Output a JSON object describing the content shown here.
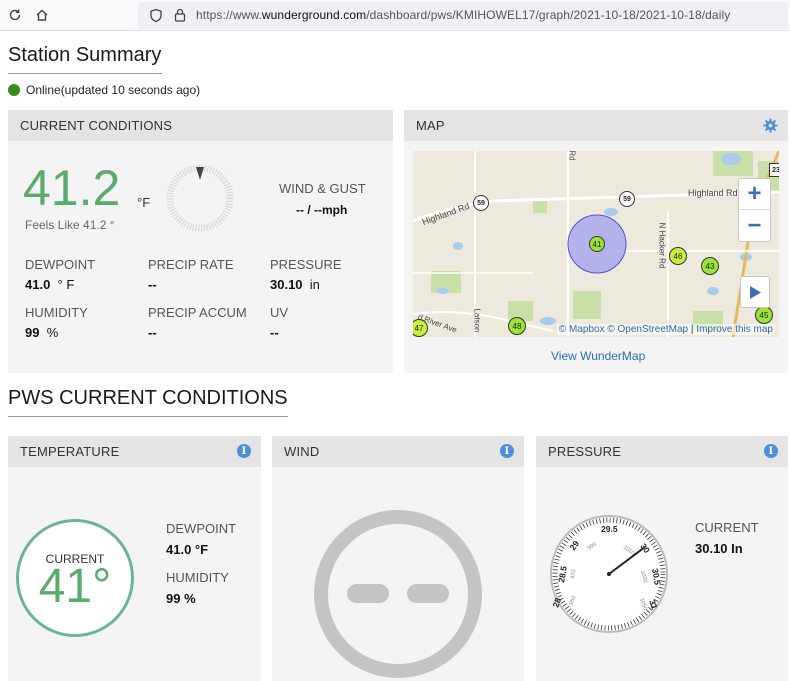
{
  "browser": {
    "url_prefix": "https://www.",
    "url_host": "wunderground.com",
    "url_path": "/dashboard/pws/KMIHOWEL17/graph/2021-10-18/2021-10-18/daily"
  },
  "station_summary": {
    "title": "Station Summary",
    "status_text": "Online(updated 10 seconds ago)",
    "status_color": "#3a8a1c"
  },
  "current_conditions": {
    "header": "CURRENT CONDITIONS",
    "temperature": "41.2",
    "temp_unit": "°F",
    "feels_like": "Feels Like 41.2 °",
    "wind_label": "WIND & GUST",
    "wind_value": "-- / --mph",
    "dewpoint_label": "DEWPOINT",
    "dewpoint_value": "41.0",
    "dewpoint_unit": "° F",
    "precip_rate_label": "PRECIP RATE",
    "precip_rate_value": "--",
    "pressure_label": "PRESSURE",
    "pressure_value": "30.10",
    "pressure_unit": "in",
    "humidity_label": "HUMIDITY",
    "humidity_value": "99",
    "humidity_unit": "%",
    "precip_accum_label": "PRECIP ACCUM",
    "precip_accum_value": "--",
    "uv_label": "UV",
    "uv_value": "--"
  },
  "map": {
    "header": "MAP",
    "attribution_mapbox": "© Mapbox",
    "attribution_osm": "© OpenStreetMap",
    "attribution_sep": "|",
    "attribution_improve": "Improve this map",
    "view_link": "View WunderMap",
    "roads": {
      "highland_rd_left": "Highland Rd",
      "highland_rd_right": "Highland Rd",
      "n_hacker_rd": "N Hacker Rd",
      "rd_top": "Rd",
      "latson": "Latson",
      "river_ave": "d River Ave"
    },
    "route_shields": [
      "59",
      "59",
      "23"
    ],
    "station_markers": [
      "41",
      "46",
      "43",
      "45",
      "47",
      "48"
    ]
  },
  "pws_current": {
    "title": "PWS CURRENT CONDITIONS",
    "temperature_card": {
      "header": "TEMPERATURE",
      "gauge_label": "CURRENT",
      "gauge_value": "41°",
      "dewpoint_label": "DEWPOINT",
      "dewpoint_value": "41.0 °F",
      "humidity_label": "HUMIDITY",
      "humidity_value": "99 %"
    },
    "wind_card": {
      "header": "WIND"
    },
    "pressure_card": {
      "header": "PRESSURE",
      "current_label": "CURRENT",
      "current_value": "30.10 In",
      "dial_major": [
        "28",
        "28.5",
        "29",
        "29.5",
        "30",
        "30.5",
        "31"
      ],
      "dial_minor": [
        "950",
        "970",
        "990",
        "1010",
        "1030",
        "1050"
      ]
    }
  },
  "colors": {
    "temp_green": "#5aab6e",
    "accent_blue": "#4a90d9",
    "marker_lime": "#9be337",
    "station_circle": "#6b6be0"
  }
}
